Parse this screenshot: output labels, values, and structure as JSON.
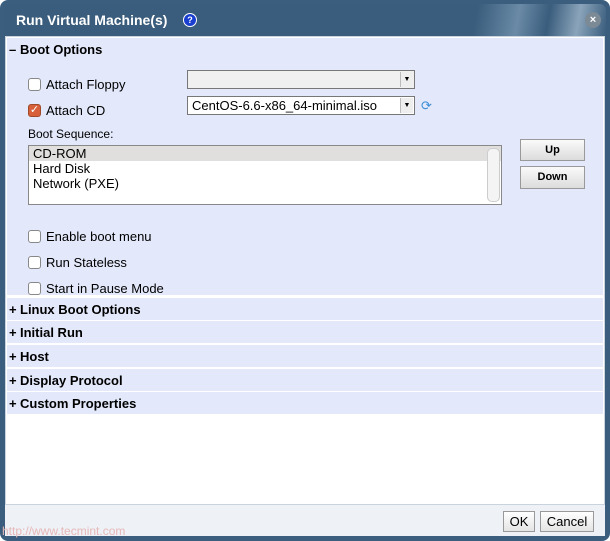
{
  "dialog": {
    "title": "Run Virtual Machine(s)",
    "help_icon": "?",
    "close_icon": "×"
  },
  "boot_options": {
    "header": "Boot Options",
    "sign": "–",
    "attach_floppy": {
      "label": "Attach Floppy",
      "checked": false,
      "value": ""
    },
    "attach_cd": {
      "label": "Attach CD",
      "checked": true,
      "value": "CentOS-6.6-x86_64-minimal.iso"
    },
    "boot_sequence_label": "Boot Sequence:",
    "boot_sequence": [
      "CD-ROM",
      "Hard Disk",
      "Network (PXE)"
    ],
    "up_label": "Up",
    "down_label": "Down",
    "enable_boot_menu": "Enable boot menu",
    "run_stateless": "Run Stateless",
    "start_paused": "Start in Pause Mode"
  },
  "sections": [
    {
      "sign": "+",
      "label": "Linux Boot Options"
    },
    {
      "sign": "+",
      "label": "Initial Run"
    },
    {
      "sign": "+",
      "label": "Host"
    },
    {
      "sign": "+",
      "label": "Display Protocol"
    },
    {
      "sign": "+",
      "label": "Custom Properties"
    }
  ],
  "footer": {
    "ok": "OK",
    "cancel": "Cancel"
  },
  "watermark": "http://www.tecmint.com"
}
